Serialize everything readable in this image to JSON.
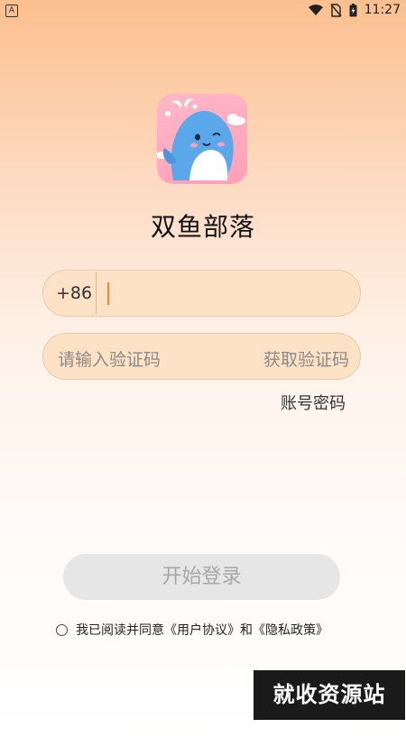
{
  "status_bar": {
    "left_badge": "A",
    "time": "11:27",
    "icons": [
      "wifi-icon",
      "no-sim-icon",
      "battery-icon"
    ]
  },
  "app": {
    "title": "双鱼部落",
    "logo": "whale-mascot-logo"
  },
  "phone_field": {
    "country_code": "+86",
    "value": ""
  },
  "code_field": {
    "placeholder": "请输入验证码",
    "get_code_label": "获取验证码"
  },
  "links": {
    "password_login": "账号密码"
  },
  "login_button": {
    "label": "开始登录"
  },
  "agreement": {
    "text": "我已阅读并同意《用户协议》和《隐私政策》",
    "checked": false
  },
  "watermark": {
    "text": "就收资源站"
  },
  "colors": {
    "accent": "#f08a2d",
    "field_bg": "#fde2c6",
    "button_disabled": "#e6e6e6"
  }
}
